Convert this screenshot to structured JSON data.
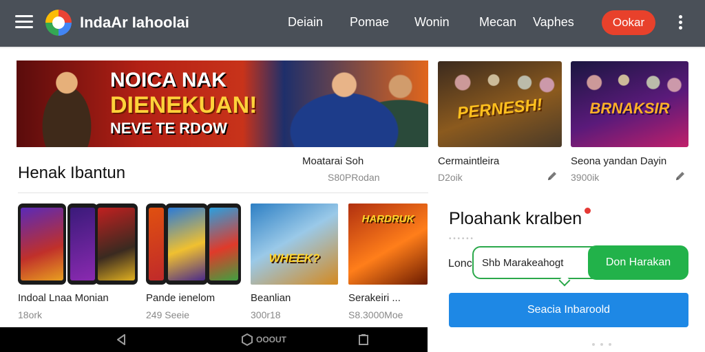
{
  "app": {
    "title": "IndaAr Iahoolai",
    "accent": "#e8412b",
    "bar_color": "#4a5058"
  },
  "nav": {
    "items": [
      "Deiain",
      "Pomae",
      "Wonin",
      "Mecan",
      "Vaphes"
    ],
    "cta": "Ookar"
  },
  "hero": {
    "line1": "NOICA NAK",
    "line2": "DIENEKUAN!",
    "line3": "NEVE TE RDOW"
  },
  "featured": [
    {
      "art_title": "PERNESH!",
      "title": "Cermaintleira",
      "sub": "D2oik"
    },
    {
      "art_title": "BRNAKSIR",
      "title": "Seona yandan Dayin",
      "sub": "3900ik"
    }
  ],
  "hero_meta": {
    "title": "Moatarai Soh",
    "sub": "S80PRodan"
  },
  "section": {
    "title": "Henak Ibantun"
  },
  "apps": [
    {
      "name": "Indoal Lnaa Monian",
      "sub": "18ork"
    },
    {
      "name": "Pande ienelom",
      "sub": "249 Seeie"
    },
    {
      "name": "Beanlian",
      "sub": "300r18",
      "art_title": "WHEEK?"
    },
    {
      "name": "Serakeiri ...",
      "sub": "S8.3000Moe",
      "art_title": "HARDRUK"
    }
  ],
  "side_card": {
    "title": "Ploahank kralben",
    "hint": "• •  •  •  •  •",
    "row_label": "Lonc",
    "input_placeholder": "Shb Marakeahogt",
    "confirm_label": "Don Harakan",
    "primary_label": "Seacia Inbaroold"
  },
  "system_nav": {
    "home_label": "OOOUT"
  },
  "colors": {
    "green": "#22b24a",
    "blue": "#1e88e5",
    "dot": "#e53935"
  }
}
